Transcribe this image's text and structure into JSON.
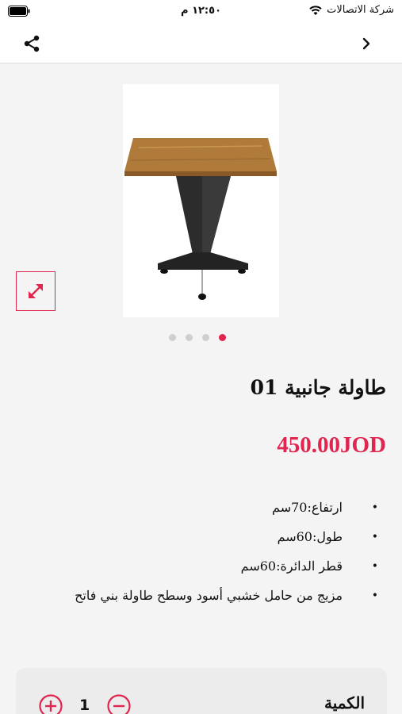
{
  "status_bar": {
    "carrier": "شركة الاتصالات",
    "time": "١٢:٥٠ م"
  },
  "nav": {
    "back_icon": "chevron-right-icon",
    "share_icon": "share-icon"
  },
  "product": {
    "image_icon": "side-table-image",
    "expand_icon": "expand-arrows-icon",
    "carousel": {
      "total": 4,
      "active_index": 3
    },
    "title": "طاولة جانبية 01",
    "price": "450.00JOD",
    "specs": [
      "ارتفاع:70سم",
      "طول:60سم",
      "قطر الدائرة:60سم",
      "مزيج من حامل خشبي أسود وسطح طاولة بني فاتح"
    ]
  },
  "quantity": {
    "label": "الكمية",
    "value": "1",
    "plus_icon": "plus-circle-icon",
    "minus_icon": "minus-circle-icon"
  },
  "colors": {
    "accent": "#e0254f",
    "background": "#f4f4f4",
    "card": "#ececec"
  }
}
